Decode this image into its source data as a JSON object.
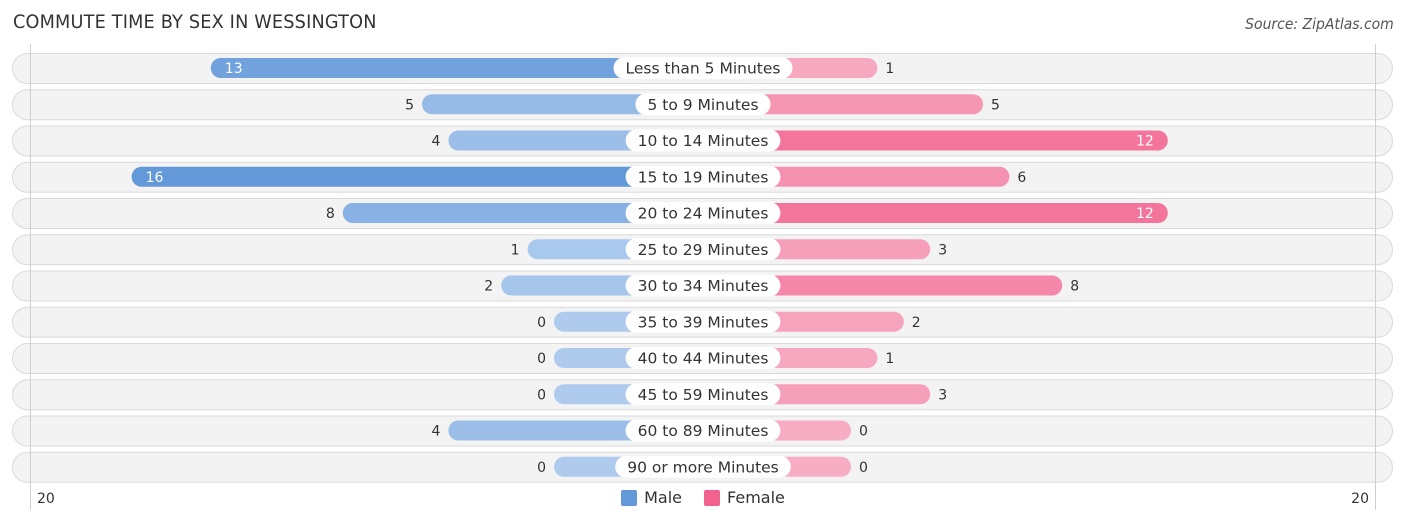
{
  "chart_data": {
    "type": "bar",
    "orientation": "horizontal-diverging",
    "title": "COMMUTE TIME BY SEX IN WESSINGTON",
    "source": "Source: ZipAtlas.com",
    "categories": [
      "Less than 5 Minutes",
      "5 to 9 Minutes",
      "10 to 14 Minutes",
      "15 to 19 Minutes",
      "20 to 24 Minutes",
      "25 to 29 Minutes",
      "30 to 34 Minutes",
      "35 to 39 Minutes",
      "40 to 44 Minutes",
      "45 to 59 Minutes",
      "60 to 89 Minutes",
      "90 or more Minutes"
    ],
    "series": [
      {
        "name": "Male",
        "side": "left",
        "color": "#6399d9",
        "light_color": "#aecbee",
        "values": [
          13,
          5,
          4,
          16,
          8,
          1,
          2,
          0,
          0,
          0,
          4,
          0
        ]
      },
      {
        "name": "Female",
        "side": "right",
        "color": "#f2628f",
        "light_color": "#f7adc4",
        "values": [
          1,
          5,
          12,
          6,
          12,
          3,
          8,
          2,
          1,
          3,
          0,
          0
        ]
      }
    ],
    "axis": {
      "left_tick": "20",
      "right_tick": "20",
      "xlim": [
        -20,
        20
      ]
    },
    "legend": {
      "position": "bottom-center",
      "items": [
        "Male",
        "Female"
      ]
    },
    "grid": false
  }
}
